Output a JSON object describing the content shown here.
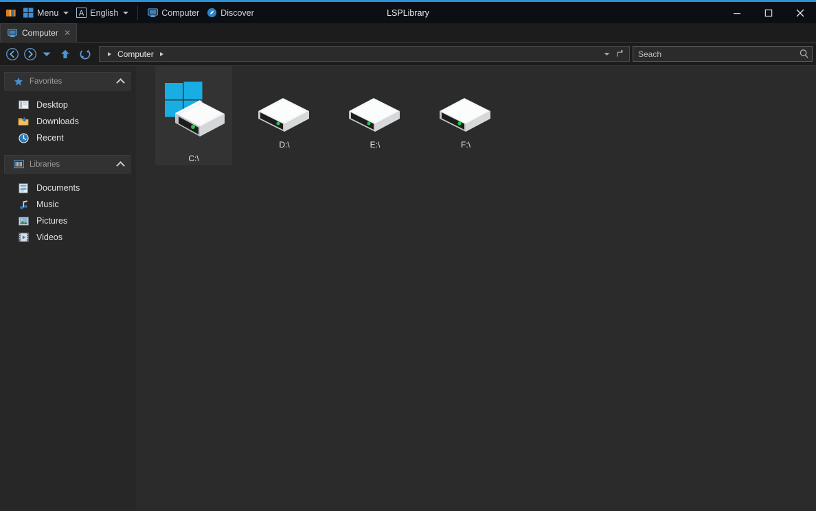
{
  "window": {
    "title": "LSPLibrary",
    "accent_color": "#2f8fd8",
    "controls": {
      "minimize_label": "–",
      "maximize_label": "□",
      "close_label": "✕"
    }
  },
  "menubar": {
    "items": [
      {
        "label": "Menu",
        "icon": "windows-logo-icon",
        "has_caret": true
      },
      {
        "label": "English",
        "icon": "language-a-icon",
        "has_caret": true
      }
    ],
    "shortcuts": [
      {
        "label": "Computer",
        "icon": "monitor-icon"
      },
      {
        "label": "Discover",
        "icon": "compass-icon"
      }
    ],
    "app_icon": "books-icon"
  },
  "tabs": [
    {
      "label": "Computer",
      "icon": "monitor-icon",
      "close_label": "✕",
      "active": true
    }
  ],
  "toolbar": {
    "buttons": [
      {
        "name": "back",
        "icon": "arrow-left-circle-icon",
        "glyph": "←"
      },
      {
        "name": "forward",
        "icon": "arrow-right-circle-icon",
        "glyph": "→"
      },
      {
        "name": "history",
        "icon": "chevron-down-icon",
        "glyph": "▾"
      },
      {
        "name": "up",
        "icon": "arrow-up-icon",
        "glyph": "↑"
      },
      {
        "name": "reload",
        "icon": "refresh-icon",
        "glyph": "↻"
      }
    ],
    "path": {
      "crumbs": [
        "Computer"
      ],
      "dropdown_icon": "chevron-down-icon",
      "edit_icon": "edit-path-icon"
    }
  },
  "search": {
    "placeholder": "Seach",
    "value": "",
    "icon": "search-icon"
  },
  "sidebar": {
    "groups": [
      {
        "title": "Favorites",
        "icon": "star-icon",
        "collapse_icon": "chevron-up-icon",
        "items": [
          {
            "label": "Desktop",
            "icon": "desktop-icon"
          },
          {
            "label": "Downloads",
            "icon": "downloads-folder-icon"
          },
          {
            "label": "Recent",
            "icon": "clock-icon"
          }
        ]
      },
      {
        "title": "Libraries",
        "icon": "library-icon",
        "collapse_icon": "chevron-up-icon",
        "items": [
          {
            "label": "Documents",
            "icon": "document-icon"
          },
          {
            "label": "Music",
            "icon": "music-note-icon"
          },
          {
            "label": "Pictures",
            "icon": "picture-icon"
          },
          {
            "label": "Videos",
            "icon": "video-icon"
          }
        ]
      }
    ]
  },
  "content": {
    "view": "icons",
    "drives": [
      {
        "label": "C:\\",
        "icon": "hard-drive-windows-icon",
        "selected": true,
        "size": "large"
      },
      {
        "label": "D:\\",
        "icon": "hard-drive-icon",
        "selected": false,
        "size": "small"
      },
      {
        "label": "E:\\",
        "icon": "hard-drive-icon",
        "selected": false,
        "size": "small"
      },
      {
        "label": "F:\\",
        "icon": "hard-drive-icon",
        "selected": false,
        "size": "small"
      }
    ]
  },
  "colors": {
    "window_bg": "#2b2b2b",
    "titlebar_bg": "#0b0f14",
    "sidebar_bg": "#272727",
    "accent_blue": "#2f8fd8",
    "icon_blue": "#6ea8dc",
    "selection_bg": "#333333",
    "text_primary": "#e4e7ea",
    "text_muted": "#9a9a9a",
    "drive_led_green": "#21c742"
  }
}
